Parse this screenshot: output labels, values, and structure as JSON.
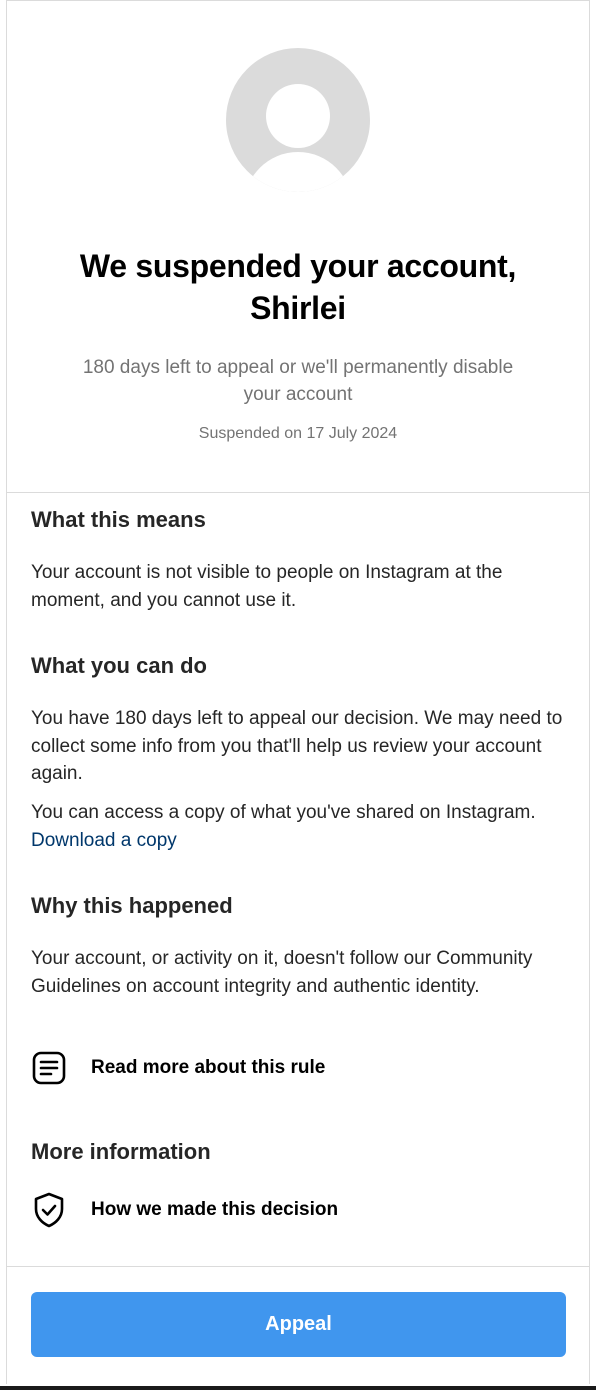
{
  "header": {
    "title": "We suspended your account, Shirlei",
    "subtitle": "180 days left to appeal or we'll permanently disable your account",
    "suspended_date": "Suspended on 17 July 2024"
  },
  "sections": {
    "means": {
      "heading": "What this means",
      "body": "Your account is not visible to people on Instagram at the moment, and you cannot use it."
    },
    "can_do": {
      "heading": "What you can do",
      "body1": "You have 180 days left to appeal our decision. We may need to collect some info from you that'll help us review your account again.",
      "body2": "You can access a copy of what you've shared on Instagram.",
      "download_link": "Download a copy"
    },
    "why": {
      "heading": "Why this happened",
      "body": "Your account, or activity on it, doesn't follow our Community Guidelines on account integrity and authentic identity.",
      "rule_link": "Read more about this rule",
      "rule_icon": "document-icon"
    },
    "more": {
      "heading": "More information",
      "decision_link": "How we made this decision",
      "decision_icon": "shield-check-icon"
    }
  },
  "footer": {
    "appeal_label": "Appeal",
    "accent": "#4096ee"
  }
}
